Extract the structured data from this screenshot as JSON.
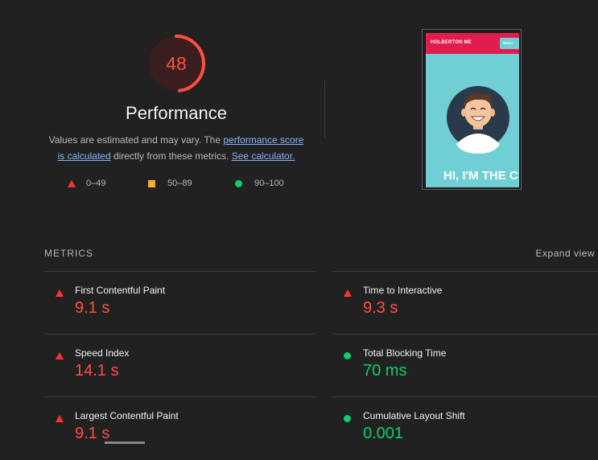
{
  "gauge": {
    "score": "48",
    "fraction": 0.48,
    "color": "#ff4e42"
  },
  "performance": {
    "title": "Performance",
    "desc_1": "Values are estimated and may vary. The ",
    "link_score": "performance score is calculated",
    "desc_2": " directly from these metrics. ",
    "link_calc": "See calculator."
  },
  "legend": [
    {
      "icon": "triangle",
      "label": "0–49",
      "color": "#ff3333"
    },
    {
      "icon": "square",
      "label": "50–89",
      "color": "#ffaa33"
    },
    {
      "icon": "circle",
      "label": "90–100",
      "color": "#0cce6b"
    }
  ],
  "screenshot": {
    "brand": "HOLBERTON ME",
    "menu": "MENU",
    "hero": "HI, I'M THE CHECKER!"
  },
  "metrics": {
    "label": "METRICS",
    "expand_label": "Expand view",
    "items": [
      {
        "title": "First Contentful Paint",
        "value": "9.1 s",
        "status": "fail"
      },
      {
        "title": "Time to Interactive",
        "value": "9.3 s",
        "status": "fail"
      },
      {
        "title": "Speed Index",
        "value": "14.1 s",
        "status": "fail"
      },
      {
        "title": "Total Blocking Time",
        "value": "70 ms",
        "status": "pass"
      },
      {
        "title": "Largest Contentful Paint",
        "value": "9.1 s",
        "status": "fail"
      },
      {
        "title": "Cumulative Layout Shift",
        "value": "0.001",
        "status": "pass"
      }
    ]
  },
  "colors": {
    "fail": "#ff4e42",
    "pass": "#0cce6b",
    "average": "#ffaa33",
    "background": "#212121"
  }
}
